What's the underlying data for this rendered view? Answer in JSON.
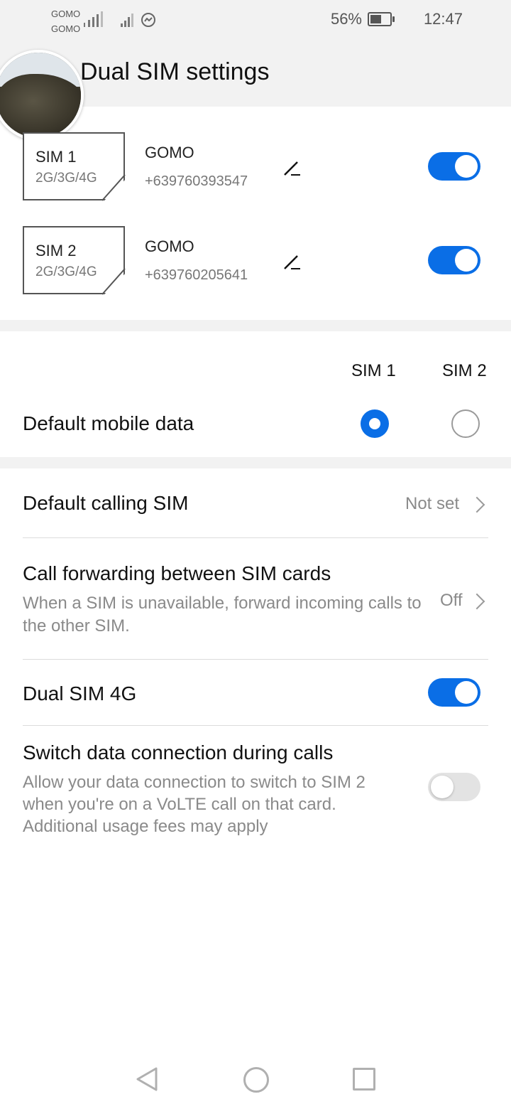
{
  "status_bar": {
    "carrier_1": "GOMO",
    "carrier_2": "GOMO",
    "battery": "56%",
    "time": "12:47",
    "battery_level": 0.56
  },
  "header": {
    "title": "Dual SIM settings"
  },
  "sims": [
    {
      "slot": "SIM 1",
      "type": "2G/3G/4G",
      "carrier": "GOMO",
      "number": "+639760393547",
      "enabled": true
    },
    {
      "slot": "SIM 2",
      "type": "2G/3G/4G",
      "carrier": "GOMO",
      "number": "+639760205641",
      "enabled": true
    }
  ],
  "mobile_data": {
    "columns": [
      "SIM 1",
      "SIM 2"
    ],
    "label": "Default mobile data",
    "selected": "SIM 1"
  },
  "settings": {
    "default_calling": {
      "label": "Default calling SIM",
      "value": "Not set"
    },
    "call_forwarding": {
      "label": "Call forwarding between SIM cards",
      "description": "When a SIM is unavailable, forward incoming calls to the other SIM.",
      "value": "Off"
    },
    "dual_sim_4g": {
      "label": "Dual SIM 4G",
      "enabled": true
    },
    "switch_data": {
      "label": "Switch data connection during calls",
      "description": "Allow your data connection to switch to SIM 2 when you're on a VoLTE call on that card. Additional usage fees may apply",
      "enabled": false
    }
  },
  "colors": {
    "accent": "#0a6ee6",
    "background": "#f2f2f2"
  },
  "icons": [
    "signal-icon",
    "messenger-icon",
    "battery-icon",
    "edit-icon",
    "chevron-right-icon",
    "back-icon",
    "home-icon",
    "recents-icon"
  ]
}
